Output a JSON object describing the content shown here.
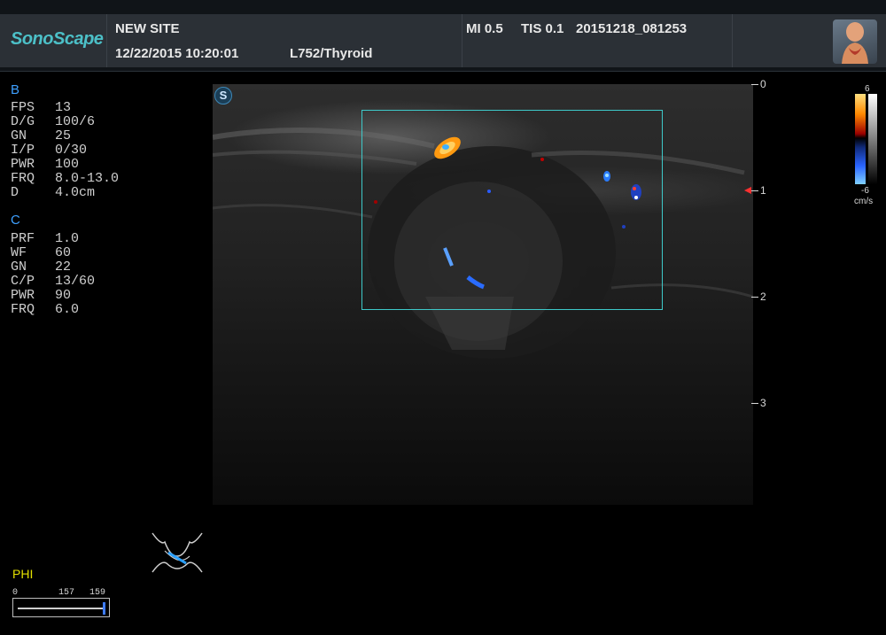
{
  "header": {
    "logo": "SonoScape",
    "site": "NEW SITE",
    "datetime": "12/22/2015 10:20:01",
    "probe_preset": "L752/Thyroid",
    "mi": "MI 0.5",
    "tis": "TIS 0.1",
    "exam_id": "20151218_081253"
  },
  "b_mode": {
    "title": "B",
    "params": [
      {
        "key": "FPS",
        "value": "13"
      },
      {
        "key": "D/G",
        "value": "100/6"
      },
      {
        "key": "GN",
        "value": "25"
      },
      {
        "key": "I/P",
        "value": "0/30"
      },
      {
        "key": "PWR",
        "value": "100"
      },
      {
        "key": "FRQ",
        "value": "8.0-13.0"
      },
      {
        "key": "D",
        "value": "4.0cm"
      }
    ]
  },
  "c_mode": {
    "title": "C",
    "params": [
      {
        "key": "PRF",
        "value": "1.0"
      },
      {
        "key": "WF",
        "value": "60"
      },
      {
        "key": "GN",
        "value": "22"
      },
      {
        "key": "C/P",
        "value": "13/60"
      },
      {
        "key": "PWR",
        "value": "90"
      },
      {
        "key": "FRQ",
        "value": "6.0"
      }
    ]
  },
  "depth_scale": [
    "0",
    "1",
    "2",
    "3"
  ],
  "color_bar": {
    "top": "6",
    "bottom": "-6",
    "unit": "cm/s"
  },
  "image_marker": "S",
  "phi": {
    "label": "PHI",
    "min": "0",
    "value": "157",
    "max": "159",
    "level": 0.987
  },
  "icons": [
    "body-mark-thyroid-icon",
    "probe-position-icon",
    "sono-s-icon"
  ]
}
